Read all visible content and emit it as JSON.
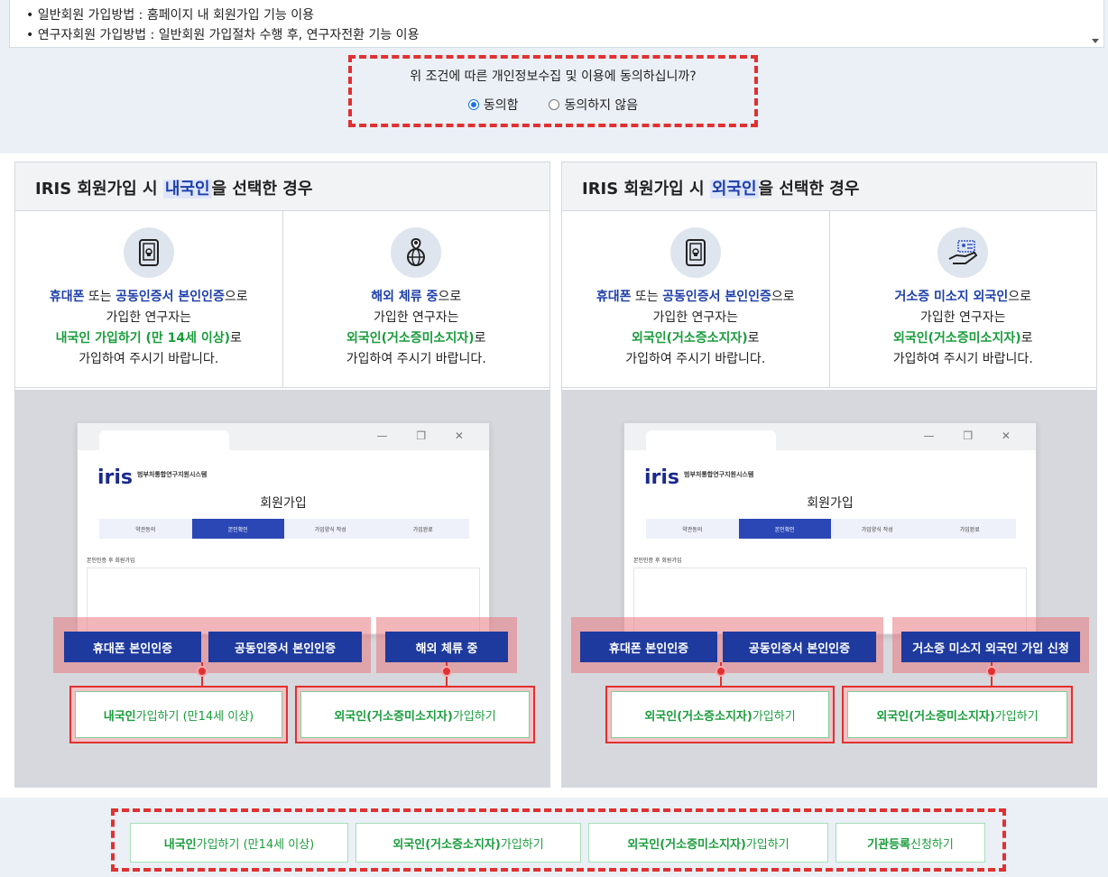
{
  "terms": {
    "line1": "• 일반회원 가입방법 : 홈페이지 내 회원가입 기능 이용",
    "line2": "• 연구자회원 가입방법 : 일반회원 가입절차 수행 후, 연구자전환 기능 이용"
  },
  "consent": {
    "question": "위 조건에 따른 개인정보수집 및 이용에 동의하십니까?",
    "agree": "동의함",
    "disagree": "동의하지 않음",
    "selected": "agree"
  },
  "domestic": {
    "title_pre": "IRIS 회원가입 시 ",
    "title_hl": "내국인",
    "title_post": "을 선택한 경우",
    "left": {
      "l1a": "휴대폰",
      "l1b": " 또는 ",
      "l1c": "공동인증서 본인인증",
      "l1d": "으로",
      "l2": "가입한 연구자는",
      "l3a": "내국인",
      "l3b": " 가입하기 (만 14세 이상)",
      "l3c": "로",
      "l4": "가입하여 주시기 바랍니다."
    },
    "right": {
      "l1a": "해외 체류 중",
      "l1b": "으로",
      "l2": "가입한 연구자는",
      "l3a": "외국인(거소증미소지자)",
      "l3b": "로",
      "l4": "가입하여 주시기 바랍니다."
    },
    "btn1": "휴대폰 본인인증",
    "btn2": "공동인증서 본인인증",
    "btn3": "해외 체류 중",
    "gbtn1_a": "내국인",
    "gbtn1_b": " 가입하기 (만14세 이상)",
    "gbtn2_a": "외국인(거소증미소지자)",
    "gbtn2_b": " 가입하기"
  },
  "foreign": {
    "title_pre": "IRIS 회원가입 시 ",
    "title_hl": "외국인",
    "title_post": "을 선택한 경우",
    "left": {
      "l1a": "휴대폰",
      "l1b": " 또는 ",
      "l1c": "공동인증서 본인인증",
      "l1d": "으로",
      "l2": "가입한 연구자는",
      "l3a": "외국인(거소증소지자)",
      "l3b": "로",
      "l4": "가입하여 주시기 바랍니다."
    },
    "right": {
      "l1a": "거소증 미소지 외국인",
      "l1b": "으로",
      "l2": "가입한 연구자는",
      "l3a": "외국인(거소증미소지자)",
      "l3b": "로",
      "l4": "가입하여 주시기 바랍니다."
    },
    "btn1": "휴대폰 본인인증",
    "btn2": "공동인증서 본인인증",
    "btn3": "거소증 미소지 외국인 가입 신청",
    "gbtn1_a": "외국인(거소증소지자)",
    "gbtn1_b": " 가입하기",
    "gbtn2_a": "외국인(거소증미소지자)",
    "gbtn2_b": " 가입하기"
  },
  "mock": {
    "logo": "iris",
    "logo_sub": "범부처통합연구지원시스템",
    "title": "회원가입",
    "steps": [
      "약관동의",
      "본인확인",
      "가입양식 작성",
      "가입완료"
    ],
    "section": "본인인증 후 회원가입",
    "controls": "— ❐ ✕"
  },
  "bottom": {
    "b1a": "내국인",
    "b1b": " 가입하기 (만14세 이상)",
    "b2a": "외국인(거소증소지자)",
    "b2b": " 가입하기",
    "b3a": "외국인(거소증미소지자)",
    "b3b": " 가입하기",
    "b4a": "기관등록",
    "b4b": " 신청하기"
  }
}
